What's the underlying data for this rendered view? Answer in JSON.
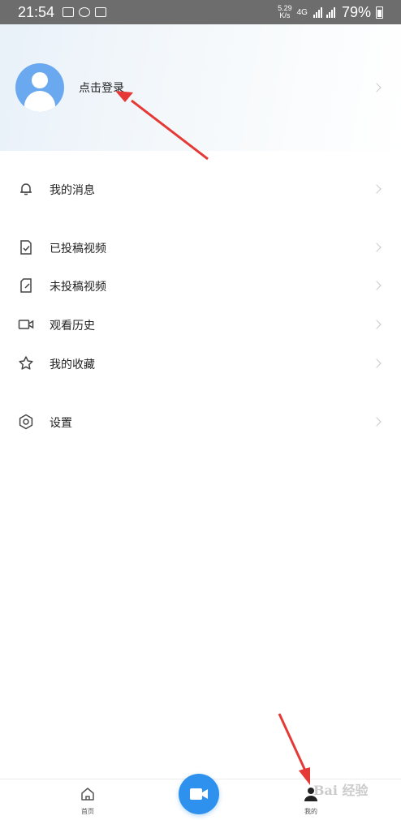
{
  "status_bar": {
    "time": "21:54",
    "speed_value": "5.29",
    "speed_unit": "K/s",
    "network": "4G",
    "battery": "79%"
  },
  "profile": {
    "login_text": "点击登录",
    "avatar_color": "#6aa9ef"
  },
  "menu": {
    "messages": "我的消息",
    "posted_videos": "已投稿视频",
    "unposted_videos": "未投稿视频",
    "watch_history": "观看历史",
    "favorites": "我的收藏",
    "settings": "设置"
  },
  "tabbar": {
    "home_label": "首页",
    "mine_label": "我的",
    "accent": "#2f91ee"
  },
  "annotation": {
    "arrow_color": "#e53935"
  },
  "watermark": "Bai 经验"
}
